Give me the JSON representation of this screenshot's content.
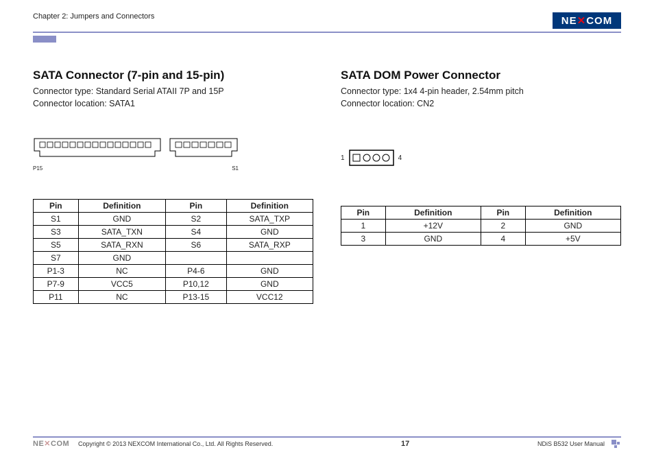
{
  "header": {
    "chapter": "Chapter 2: Jumpers and Connectors",
    "logo_text": "NEXCOM"
  },
  "left": {
    "title": "SATA Connector (7-pin and 15-pin)",
    "conn_type": "Connector type: Standard Serial ATAII 7P and 15P",
    "conn_loc": "Connector location: SATA1",
    "diag_left_label": "P15",
    "diag_right_label": "S1",
    "table": {
      "headers": [
        "Pin",
        "Definition",
        "Pin",
        "Definition"
      ],
      "rows": [
        [
          "S1",
          "GND",
          "S2",
          "SATA_TXP"
        ],
        [
          "S3",
          "SATA_TXN",
          "S4",
          "GND"
        ],
        [
          "S5",
          "SATA_RXN",
          "S6",
          "SATA_RXP"
        ],
        [
          "S7",
          "GND",
          "",
          ""
        ],
        [
          "P1-3",
          "NC",
          "P4-6",
          "GND"
        ],
        [
          "P7-9",
          "VCC5",
          "P10,12",
          "GND"
        ],
        [
          "P11",
          "NC",
          "P13-15",
          "VCC12"
        ]
      ]
    }
  },
  "right": {
    "title": "SATA DOM Power Connector",
    "conn_type": "Connector type: 1x4 4-pin header, 2.54mm pitch",
    "conn_loc": "Connector location: CN2",
    "diag_left_label": "1",
    "diag_right_label": "4",
    "table": {
      "headers": [
        "Pin",
        "Definition",
        "Pin",
        "Definition"
      ],
      "rows": [
        [
          "1",
          "+12V",
          "2",
          "GND"
        ],
        [
          "3",
          "GND",
          "4",
          "+5V"
        ]
      ]
    }
  },
  "footer": {
    "copyright": "Copyright © 2013 NEXCOM International Co., Ltd. All Rights Reserved.",
    "page_num": "17",
    "manual": "NDiS B532 User Manual",
    "footer_logo_text": "NEXCOM"
  }
}
